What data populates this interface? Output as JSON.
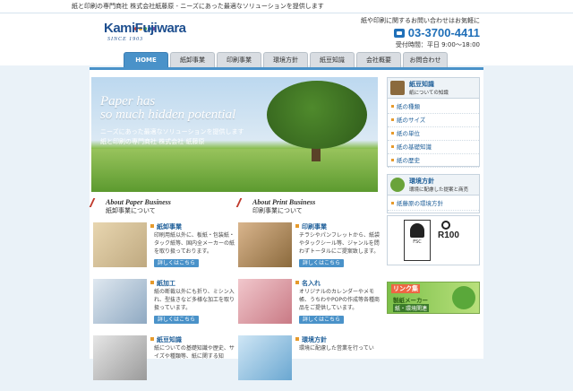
{
  "topbar": {
    "text": "紙と印刷の専門商社 株式会社紙藤原 - ニーズにあった最適なソリューションを提供します"
  },
  "logo": {
    "name": "KamiFujiwara",
    "since": "SINCE 1903",
    "dot_colors": [
      "#e6372b",
      "#f0a020",
      "#3aa148",
      "#1f6fb8",
      "#8b4aa8"
    ]
  },
  "contact": {
    "lead": "紙や印刷に関するお問い合わせはお気軽に",
    "tel": "03-3700-4411",
    "hours": "受付時間：平日 9:00～18:00"
  },
  "nav": {
    "tabs": [
      {
        "label": "HOME",
        "active": true
      },
      {
        "label": "紙卸事業"
      },
      {
        "label": "印刷事業"
      },
      {
        "label": "環境方針"
      },
      {
        "label": "紙豆知識"
      },
      {
        "label": "会社概要"
      },
      {
        "label": "お問合わせ"
      }
    ]
  },
  "hero": {
    "headline_1": "Paper has",
    "headline_2": "so much hidden potential",
    "sub_1": "ニーズにあった最適なソリューションを提供します",
    "sub_2": "紙と印刷の専門商社 株式会社 紙藤原"
  },
  "paper_section": {
    "en": "About Paper Business",
    "ja": "紙卸事業について"
  },
  "print_section": {
    "en": "About Print Business",
    "ja": "印刷事業について"
  },
  "cards": [
    {
      "title": "紙卸事業",
      "desc": "印刷用紙以外に、板紙・包装紙・タック紙等、国内全メーカーの紙を取り扱っております。",
      "more": "詳しくはこちら",
      "color": "#d7c39a"
    },
    {
      "title": "印刷事業",
      "desc": "チラシやパンフレットから、紙袋やタックシール等、ジャンルを問わずトータルにご提案致します。",
      "more": "詳しくはこちら",
      "color": "#c9a27a"
    },
    {
      "title": "紙加工",
      "desc": "紙の断裁以外にも折り、ミシン入れ、型抜きなど多様な加工を取り扱っています。",
      "more": "詳しくはこちら",
      "color": "#9fb7cf"
    },
    {
      "title": "名入れ",
      "desc": "オリジナルのカレンダーやメモ帳、うちわやPOPの作成等各種商品をご提供しています。",
      "more": "詳しくはこちら",
      "color": "#d9a0a8"
    },
    {
      "title": "紙豆知識",
      "desc": "紙についての基礎知識や歴史、サイズや種類等、紙に関する知",
      "more": "",
      "color": "#c8c8c8"
    },
    {
      "title": "環境方針",
      "desc": "環境に配慮した営業を行ってい",
      "more": "",
      "color": "#a9d0e8"
    }
  ],
  "sidebar": {
    "knowledge": {
      "title": "紙豆知識",
      "subtitle": "紙についての知識",
      "items": [
        "紙の種類",
        "紙のサイズ",
        "紙の単位",
        "紙の基礎知識",
        "紙の歴史"
      ]
    },
    "environment": {
      "title": "環境方針",
      "subtitle": "環境に配慮した提案と商売",
      "items": [
        "紙藤原の環境方針"
      ]
    }
  },
  "logos": {
    "fsc_label": "FSC",
    "r100": "R100"
  },
  "banner": {
    "line1": "リンク集",
    "line2": "製紙メーカー",
    "line3": "紙・環境関連"
  }
}
